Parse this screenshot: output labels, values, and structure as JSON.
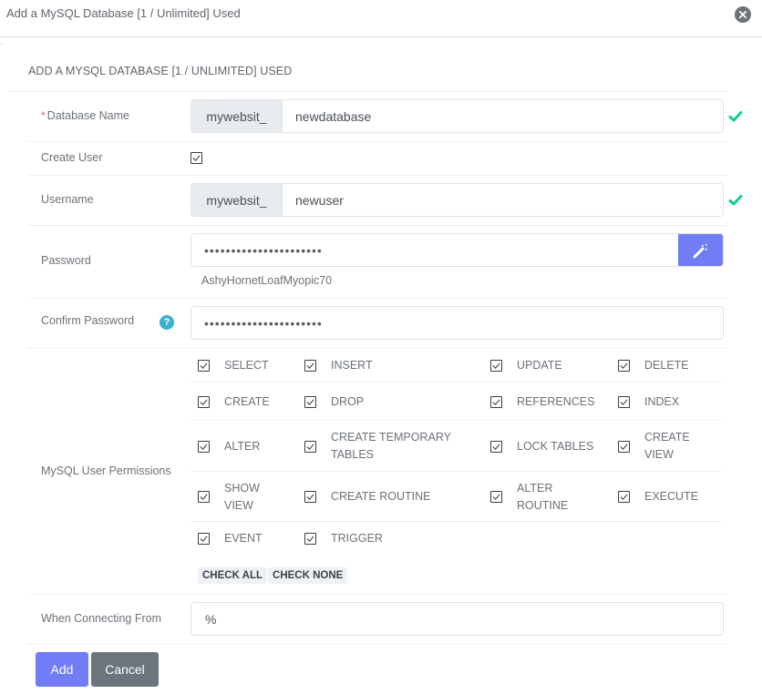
{
  "dialog": {
    "title": "Add a MySQL Database [1 / Unlimited] Used",
    "close_icon": "close-circle-icon"
  },
  "section": {
    "title": "ADD A MYSQL DATABASE [1 / UNLIMITED] USED"
  },
  "form": {
    "database_name": {
      "label": "Database Name",
      "required_marker": "*",
      "prefix": "mywebsit_",
      "value": "newdatabase",
      "valid_icon": "checkmark-icon"
    },
    "create_user": {
      "label": "Create User",
      "checked": true
    },
    "username": {
      "label": "Username",
      "prefix": "mywebsit_",
      "value": "newuser",
      "valid_icon": "checkmark-icon"
    },
    "password": {
      "label": "Password",
      "masked_value": "••••••••••••••••••••••",
      "generated_hint": "AshyHornetLoafMyopic70",
      "generate_icon": "magic-wand-icon"
    },
    "confirm_password": {
      "label": "Confirm Password",
      "help_icon": "question-circle-icon",
      "help_glyph": "?",
      "masked_value": "••••••••••••••••••••••"
    },
    "permissions": {
      "label": "MySQL User Permissions",
      "items": [
        {
          "label": "SELECT",
          "checked": true
        },
        {
          "label": "INSERT",
          "checked": true
        },
        {
          "label": "UPDATE",
          "checked": true
        },
        {
          "label": "DELETE",
          "checked": true
        },
        {
          "label": "CREATE",
          "checked": true
        },
        {
          "label": "DROP",
          "checked": true
        },
        {
          "label": "REFERENCES",
          "checked": true
        },
        {
          "label": "INDEX",
          "checked": true
        },
        {
          "label": "ALTER",
          "checked": true
        },
        {
          "label": "CREATE TEMPORARY TABLES",
          "checked": true
        },
        {
          "label": "LOCK TABLES",
          "checked": true
        },
        {
          "label": "CREATE VIEW",
          "checked": true
        },
        {
          "label": "SHOW VIEW",
          "checked": true
        },
        {
          "label": "CREATE ROUTINE",
          "checked": true
        },
        {
          "label": "ALTER ROUTINE",
          "checked": true
        },
        {
          "label": "EXECUTE",
          "checked": true
        },
        {
          "label": "EVENT",
          "checked": true
        },
        {
          "label": "TRIGGER",
          "checked": true
        }
      ],
      "check_all_label": "CHECK ALL",
      "check_none_label": "CHECK NONE"
    },
    "connecting_from": {
      "label": "When Connecting From",
      "value": "%"
    }
  },
  "actions": {
    "add_label": "Add",
    "cancel_label": "Cancel"
  },
  "colors": {
    "primary": "#727cf5",
    "secondary": "#6c757d",
    "success": "#0acf97",
    "info": "#39afd1",
    "required": "#e8547a"
  }
}
